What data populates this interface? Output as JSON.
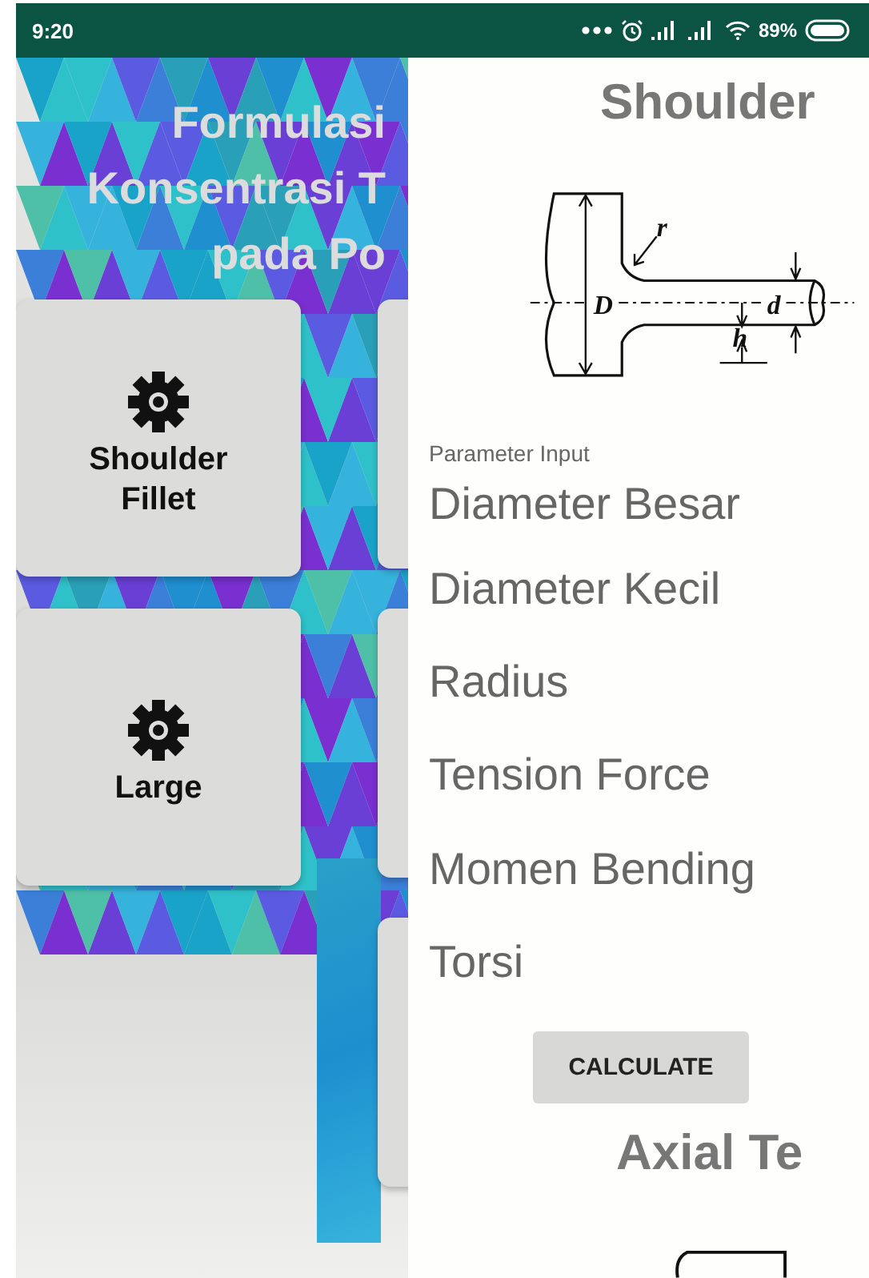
{
  "status_bar": {
    "time": "9:20",
    "battery": "89%"
  },
  "drawer": {
    "title_lines": [
      "Formulasi",
      "Konsentrasi T",
      "pada Po"
    ],
    "cards": [
      {
        "label": "Shoulder Fillet"
      },
      {
        "label": "Large"
      }
    ]
  },
  "content": {
    "title": "Shoulder",
    "diagram_labels": {
      "big_diameter": "D",
      "small_diameter": "d",
      "radius": "r",
      "height": "h"
    },
    "section_label": "Parameter Input",
    "fields": [
      {
        "placeholder": "Diameter Besar"
      },
      {
        "placeholder": "Diameter Kecil"
      },
      {
        "placeholder": "Radius"
      },
      {
        "placeholder": "Tension Force"
      },
      {
        "placeholder": "Momen Bending"
      },
      {
        "placeholder": "Torsi"
      }
    ],
    "button": "CALCULATE",
    "next_title": "Axial Te"
  }
}
